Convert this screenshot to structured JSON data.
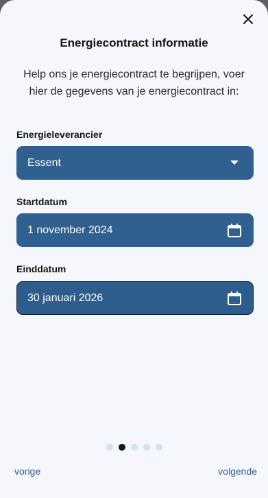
{
  "sheet": {
    "title": "Energiecontract informatie",
    "intro": "Help ons je energiecontract te begrijpen, voer hier de gegevens van je energiecontract in:",
    "close_icon": "close-icon"
  },
  "fields": {
    "supplier": {
      "label": "Energieleverancier",
      "value": "Essent",
      "icon": "dropdown-arrow-icon"
    },
    "start": {
      "label": "Startdatum",
      "value": "1 november 2024",
      "icon": "calendar-icon"
    },
    "end": {
      "label": "Einddatum",
      "value": "30 januari 2026",
      "icon": "calendar-icon"
    }
  },
  "pagination": {
    "total": 5,
    "current": 2
  },
  "nav": {
    "prev": "vorige",
    "next": "volgende"
  },
  "colors": {
    "accent": "#2f6090",
    "dot_active": "#0b1a2a",
    "dot_inactive": "#cfe3f5",
    "background": "#f6f7fd"
  }
}
